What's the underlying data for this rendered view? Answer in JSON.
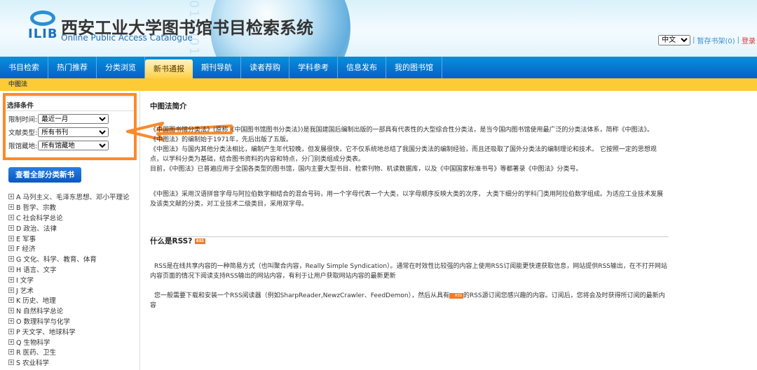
{
  "header": {
    "logo_text": "ILIB",
    "title": "西安工业大学图书馆书目检索系统",
    "subtitle": "Online Public Access Catalogue",
    "digits": "0100010101",
    "language": "中文",
    "shelf": "暂存书架(0)",
    "login": "登录",
    "sep": "|"
  },
  "nav": [
    "书目检索",
    "热门推荐",
    "分类浏览",
    "新书通报",
    "期刊导航",
    "读者荐购",
    "学科参考",
    "信息发布",
    "我的图书馆"
  ],
  "breadcrumb": "中图法",
  "filter": {
    "title": "选择条件",
    "rows": [
      {
        "label": "限制时间:",
        "value": "最近一月"
      },
      {
        "label": "文献类型:",
        "value": "所有书刊"
      },
      {
        "label": "限馆藏地:",
        "value": "所有馆藏地"
      }
    ]
  },
  "view_all": "查看全部分类新书",
  "tree": [
    "A 马列主义、毛泽东思想、邓小平理论",
    "B 哲学、宗教",
    "C 社会科学总论",
    "D 政治、法律",
    "E 军事",
    "F 经济",
    "G 文化、科学、教育、体育",
    "H 语言、文字",
    "I 文学",
    "J 艺术",
    "K 历史、地理",
    "N 自然科学总论",
    "O 数理科学与化学",
    "P 天文学、地球科学",
    "Q 生物科学",
    "R 医药、卫生",
    "S 农业科学"
  ],
  "main": {
    "intro_title": "中图法简介",
    "intro": [
      "《中国图书馆分类法》(原称《中国图书馆图书分类法》)是我国建国后编制出版的一部具有代表性的大型综合性分类法，是当今国内图书馆使用最广泛的分类法体系，简称《中图法》。",
      "《中图法》的编制始于1971年，先后出版了五版。",
      "《中图法》与国内其他分类法相比，编制产生年代较晚，但发展很快，它不仅系统地总结了我国分类法的编制经验，而且还吸取了国外分类法的编制理论和技术。 它按照一定的思想观点，以学科分类为基础，结合图书资料的内容和特点，分门别类组成分类表。",
      "目前，《中图法》已普遍应用于全国各类型的图书馆，国内主要大型书目、检索刊物、机读数据库，以及《中国国家标准书号》等都著录《中图法》分类号。"
    ],
    "intro2": "《中图法》采用汉语拼音字母与阿拉伯数字相结合的混合号码，用一个字母代表一个大类，以字母顺序反映大类的次序， 大类下细分的学科门类用阿拉伯数字组成。为适应工业技术发展及该类文献的分类，对工业技术二级类目，采用双字母。",
    "rss_title": "什么是RSS?",
    "rss_badge": "RSS",
    "rss_p1": "RSS是在线共享内容的一种简易方式（也叫聚合内容，Really Simple Syndication）。通常在时效性比较强的内容上使用RSS订阅能更快速获取信息，网站提供RSS输出，在不打开网站内容页面的情况下阅读支持RSS输出的网站内容，有利于让用户获取网站内容的最新更新",
    "rss_p2a": "您一般需要下载和安装一个RSS阅读器（例如SharpReader,NewzCrawler、FeedDemon），然后从具有",
    "rss_p2b": "的RSS源订阅您感兴趣的内容。订阅后，您将会及时获得所订阅的最新内容"
  },
  "colors": {
    "nav": "#0660c8",
    "crumb": "#fdcb35",
    "annotation": "#fb8a2d"
  }
}
